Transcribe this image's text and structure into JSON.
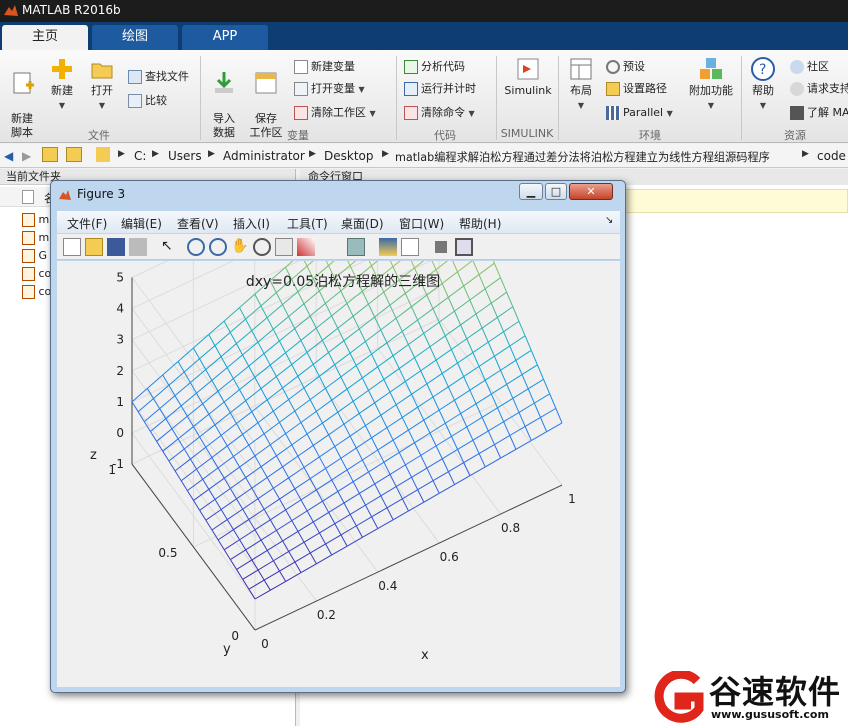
{
  "app": {
    "title": "MATLAB R2016b"
  },
  "tabs": [
    {
      "label": "主页"
    },
    {
      "label": "绘图"
    },
    {
      "label": "APP"
    }
  ],
  "ribbon": {
    "new_script": "新建\n脚本",
    "new": "新建",
    "open": "打开",
    "find_files": "查找文件",
    "compare": "比较",
    "import_data": "导入\n数据",
    "save_workspace": "保存\n工作区",
    "new_variable": "新建变量",
    "open_variable": "打开变量",
    "clear_workspace": "清除工作区",
    "analyze_code": "分析代码",
    "run_time": "运行并计时",
    "clear_commands": "清除命令",
    "simulink": "Simulink",
    "layout": "布局",
    "preferences": "预设",
    "set_path": "设置路径",
    "parallel": "Parallel",
    "addons": "附加功能",
    "help": "帮助",
    "community": "社区",
    "request_support": "请求支持",
    "learn_matlab": "了解 MA",
    "groups": {
      "file": "文件",
      "variable": "变量",
      "code": "代码",
      "simulink": "SIMULINK",
      "environment": "环境",
      "resources": "资源"
    }
  },
  "address": {
    "parts": [
      "C:",
      "Users",
      "Administrator",
      "Desktop",
      "matlab编程求解泊松方程通过差分法将泊松方程建立为线性方程组源码程序",
      "code"
    ]
  },
  "left_panel": {
    "title": "当前文件夹",
    "col": "名",
    "files": [
      "m",
      "m",
      "G",
      "co",
      "co"
    ]
  },
  "cmd_panel": {
    "title": "命令行窗口"
  },
  "figure": {
    "title": "Figure 3",
    "menu": [
      "文件(F)",
      "编辑(E)",
      "查看(V)",
      "插入(I)",
      "工具(T)",
      "桌面(D)",
      "窗口(W)",
      "帮助(H)"
    ],
    "plot_title": "dxy=0.05泊松方程解的三维图",
    "xlabel": "x",
    "ylabel": "y",
    "zlabel": "z",
    "x_ticks": [
      "0",
      "0.2",
      "0.4",
      "0.6",
      "0.8",
      "1"
    ],
    "y_ticks": [
      "0",
      "0.5",
      "1"
    ],
    "z_ticks": [
      "-1",
      "0",
      "1",
      "2",
      "3",
      "4",
      "5"
    ]
  },
  "chart_data": {
    "type": "surface",
    "title": "dxy=0.05泊松方程解的三维图",
    "xlabel": "x",
    "ylabel": "y",
    "zlabel": "z",
    "xlim": [
      0,
      1
    ],
    "ylim": [
      0,
      1
    ],
    "zlim": [
      -1,
      5
    ],
    "grid": true,
    "corner_values": {
      "x0_y0": 0,
      "x1_y0": 1,
      "x0_y1": 1,
      "x1_y1": 5
    },
    "colormap": "parula"
  },
  "watermark": {
    "brand": "谷速软件",
    "url": "www.gususoft.com"
  }
}
